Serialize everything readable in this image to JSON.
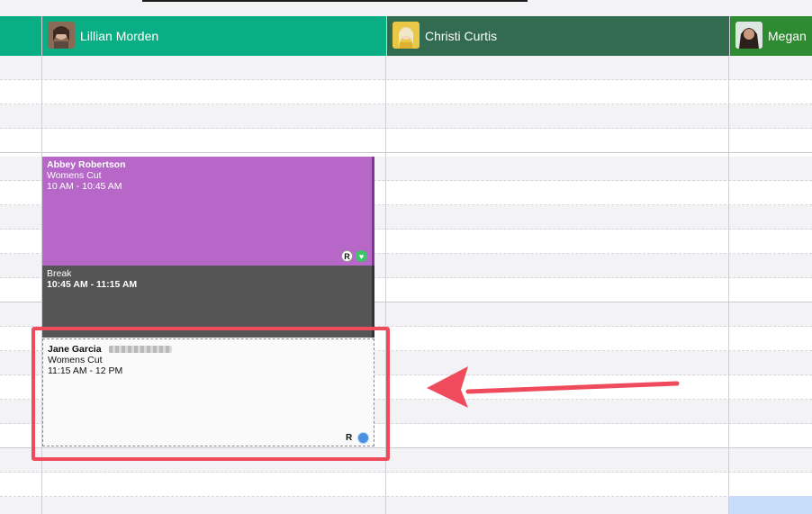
{
  "staff": [
    {
      "name": "Lillian Morden",
      "color": "#0aae84"
    },
    {
      "name": "Christi Curtis",
      "color": "#326b4f"
    },
    {
      "name": "Megan",
      "color": "#2e8b32"
    }
  ],
  "appointments": [
    {
      "client": "Abbey Robertson",
      "service": "Womens Cut",
      "time": "10 AM - 10:45 AM",
      "color": "#b667c8"
    },
    {
      "client": "Break",
      "time": "10:45 AM - 11:15 AM",
      "color": "#555555"
    },
    {
      "client": "Jane Garcia",
      "service": "Womens Cut",
      "time": "11:15 AM - 12 PM"
    }
  ],
  "badges": {
    "repeat": "R"
  },
  "icons": {
    "heart": "heart-icon",
    "status_dot": "status-dot-icon",
    "arrow": "red-arrow-icon"
  }
}
